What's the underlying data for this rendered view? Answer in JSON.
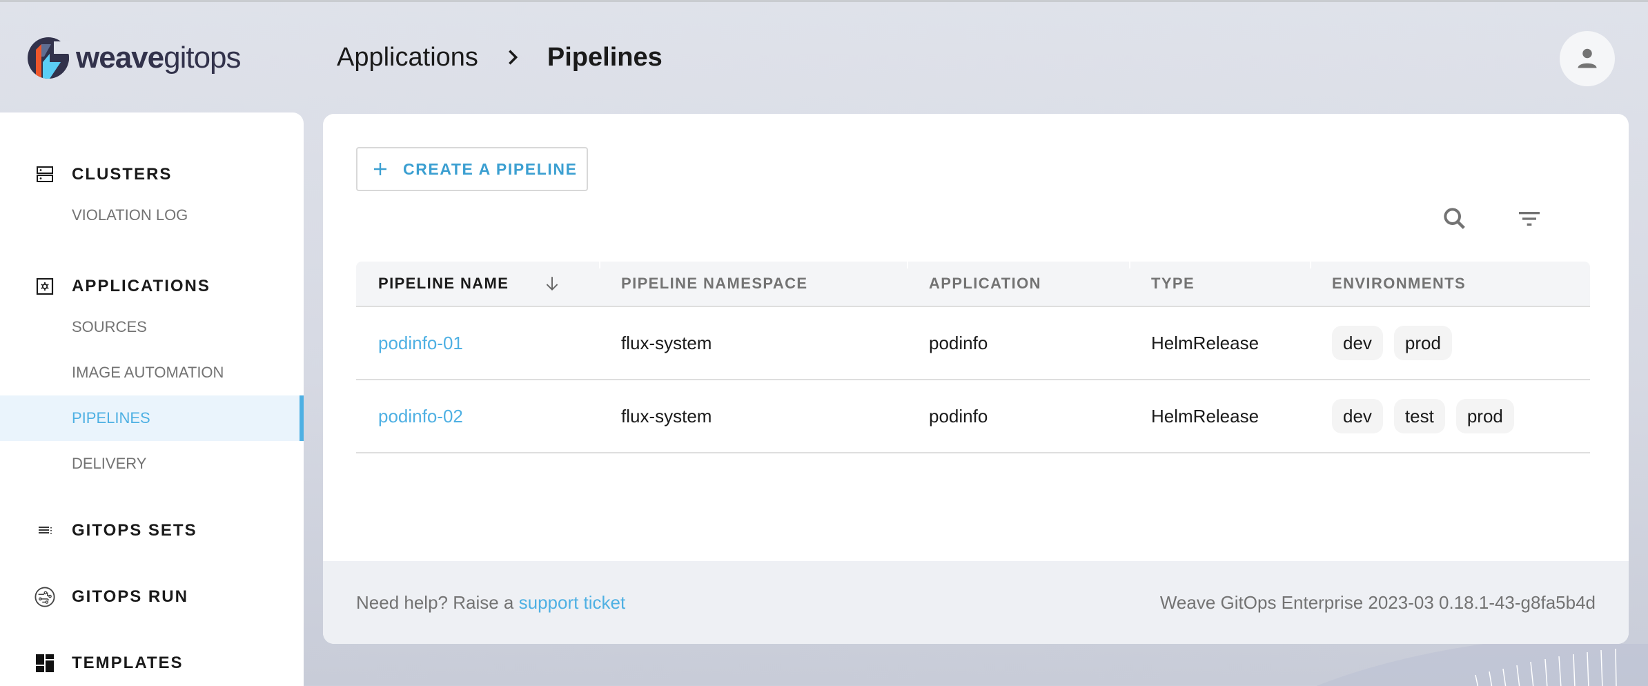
{
  "app": {
    "logo_bold": "weave",
    "logo_light": "gitops",
    "logo_colors": {
      "dark": "#32324b",
      "orange": "#f0572b",
      "cyan": "#5bcef5",
      "slate": "#5f6e92"
    }
  },
  "header": {
    "breadcrumb": [
      {
        "label": "Applications"
      },
      {
        "label": "Pipelines"
      }
    ],
    "user_icon": "person-icon"
  },
  "sidebar": {
    "groups": [
      {
        "label": "CLUSTERS",
        "icon": "server-icon",
        "items": [
          {
            "label": "VIOLATION LOG"
          }
        ]
      },
      {
        "label": "APPLICATIONS",
        "icon": "applications-icon",
        "items": [
          {
            "label": "SOURCES"
          },
          {
            "label": "IMAGE AUTOMATION"
          },
          {
            "label": "PIPELINES",
            "active": true
          },
          {
            "label": "DELIVERY"
          }
        ]
      },
      {
        "label": "GITOPS SETS",
        "icon": "list-icon",
        "items": []
      },
      {
        "label": "GITOPS RUN",
        "icon": "circuit-icon",
        "items": []
      },
      {
        "label": "TEMPLATES",
        "icon": "dashboard-icon",
        "items": []
      }
    ]
  },
  "toolbar": {
    "create_label": "CREATE A PIPELINE",
    "search_icon": "search-icon",
    "filter_icon": "filter-icon"
  },
  "table": {
    "columns": [
      {
        "label": "PIPELINE NAME",
        "sorted": "desc"
      },
      {
        "label": "PIPELINE NAMESPACE"
      },
      {
        "label": "APPLICATION"
      },
      {
        "label": "TYPE"
      },
      {
        "label": "ENVIRONMENTS"
      }
    ],
    "rows": [
      {
        "name": "podinfo-01",
        "namespace": "flux-system",
        "application": "podinfo",
        "type": "HelmRelease",
        "environments": [
          "dev",
          "prod"
        ]
      },
      {
        "name": "podinfo-02",
        "namespace": "flux-system",
        "application": "podinfo",
        "type": "HelmRelease",
        "environments": [
          "dev",
          "test",
          "prod"
        ]
      }
    ]
  },
  "footer": {
    "help_prefix": "Need help? Raise a ",
    "help_link": "support ticket",
    "version": "Weave GitOps Enterprise 2023-03 0.18.1-43-g8fa5b4d"
  },
  "colors": {
    "accent": "#4eb0e3",
    "button_text": "#3b9fd1",
    "active_bg": "#eaf4fc"
  }
}
